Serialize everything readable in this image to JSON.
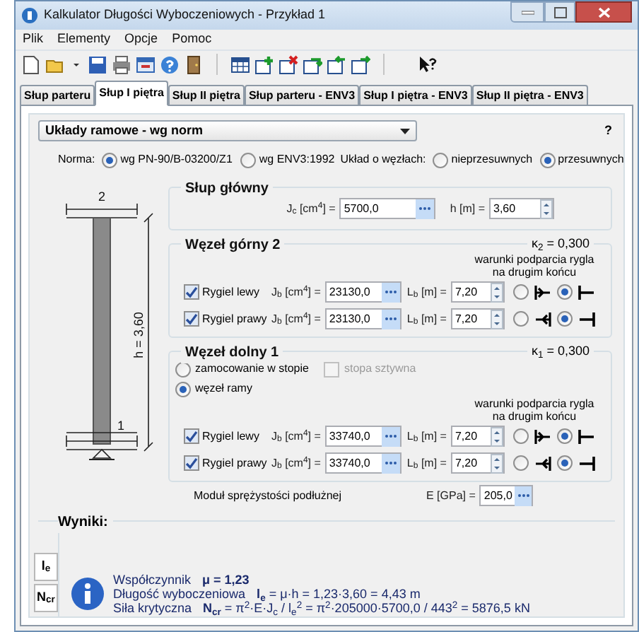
{
  "window": {
    "title": "Kalkulator Długości Wyboczeniowych - Przykład 1"
  },
  "menu": [
    "Plik",
    "Elementy",
    "Opcje",
    "Pomoc"
  ],
  "tabs": [
    {
      "label": "Słup parteru",
      "selected": false
    },
    {
      "label": "Słup I piętra",
      "selected": true
    },
    {
      "label": "Słup II piętra",
      "selected": false
    },
    {
      "label": "Słup parteru - ENV3",
      "selected": false
    },
    {
      "label": "Słup I piętra - ENV3",
      "selected": false
    },
    {
      "label": "Słup II piętra - ENV3",
      "selected": false
    }
  ],
  "system_dropdown": {
    "value": "Układy ramowe - wg norm"
  },
  "help": "?",
  "norm": {
    "label": "Norma:",
    "options": [
      {
        "label": "wg PN-90/B-03200/Z1",
        "selected": true
      },
      {
        "label": "wg ENV3:1992",
        "selected": false
      }
    ]
  },
  "nodes": {
    "label": "Układ o węzłach:",
    "options": [
      {
        "label": "nieprzesuwnych",
        "selected": false
      },
      {
        "label": "przesuwnych",
        "selected": true
      }
    ]
  },
  "diagram": {
    "top_label": "2",
    "bottom_label": "1",
    "height_label": "h = 3,60"
  },
  "main_column": {
    "title": "Słup główny",
    "fields": [
      {
        "label": "J$_{c}$ [cm$^{4}$] =",
        "value": "5700,0",
        "kind": "ellipsis"
      },
      {
        "label": "h [m] =",
        "value": "3,60",
        "kind": "spin"
      }
    ]
  },
  "top_node": {
    "title": "Węzeł górny 2",
    "kappa": "κ$_{2}$ = 0,300",
    "caption": "warunki podparcia rygla na drugim końcu",
    "beams": [
      {
        "label": "Rygiel lewy",
        "checked": true,
        "jb_label": "J$_{b}$ [cm$^{4}$] =",
        "jb": "23130,0",
        "lb_label": "L$_{b}$ [m] =",
        "lb": "7,20",
        "supports": [
          {
            "kind": "pinned",
            "selected": false
          },
          {
            "kind": "fixed",
            "selected": true
          }
        ]
      },
      {
        "label": "Rygiel prawy",
        "checked": true,
        "jb_label": "J$_{b}$ [cm$^{4}$] =",
        "jb": "23130,0",
        "lb_label": "L$_{b}$ [m] =",
        "lb": "7,20",
        "supports": [
          {
            "kind": "pinned",
            "selected": false
          },
          {
            "kind": "fixed",
            "selected": true
          }
        ]
      }
    ]
  },
  "bottom_node": {
    "title": "Węzeł dolny 1",
    "kappa": "κ$_{1}$ = 0,300",
    "base": {
      "label": "zamocowanie w stopie",
      "selected": false
    },
    "rigid_footing": {
      "label": "stopa sztywna",
      "checked": false,
      "disabled": true
    },
    "frame": {
      "label": "węzeł ramy",
      "selected": true
    },
    "caption": "warunki podparcia rygla na drugim końcu",
    "beams": [
      {
        "label": "Rygiel lewy",
        "checked": true,
        "jb_label": "J$_{b}$ [cm$^{4}$] =",
        "jb": "33740,0",
        "lb_label": "L$_{b}$ [m] =",
        "lb": "7,20",
        "supports": [
          {
            "kind": "pinned",
            "selected": false
          },
          {
            "kind": "fixed",
            "selected": true
          }
        ]
      },
      {
        "label": "Rygiel prawy",
        "checked": true,
        "jb_label": "J$_{b}$ [cm$^{4}$] =",
        "jb": "33740,0",
        "lb_label": "L$_{b}$ [m] =",
        "lb": "7,20",
        "supports": [
          {
            "kind": "pinned",
            "selected": false
          },
          {
            "kind": "fixed",
            "selected": true
          }
        ]
      }
    ]
  },
  "modulus": {
    "label": "Moduł sprężystości podłużnej",
    "field_label": "E [GPa] =",
    "value": "205,0"
  },
  "results": {
    "title": "Wyniki:",
    "side_tabs": [
      {
        "label": "l$_{e}$"
      },
      {
        "label": "N$_{cr}$"
      }
    ],
    "lines": [
      {
        "name": "Współczynnik",
        "formula": "**μ = 1,23**"
      },
      {
        "name": "Długość wyboczeniowa",
        "formula": "**l$_{e}$** = μ·h = 1,23·3,60 = 4,43 m"
      },
      {
        "name": "Siła krytyczna",
        "formula": "**N$_{cr}$** = π$^{2}$·E·J$_{c}$ / l$_{e}$$^{2}$ = π$^{2}$·205000·5700,0 / 443$^{2}$ = 5876,5 kN"
      }
    ]
  }
}
